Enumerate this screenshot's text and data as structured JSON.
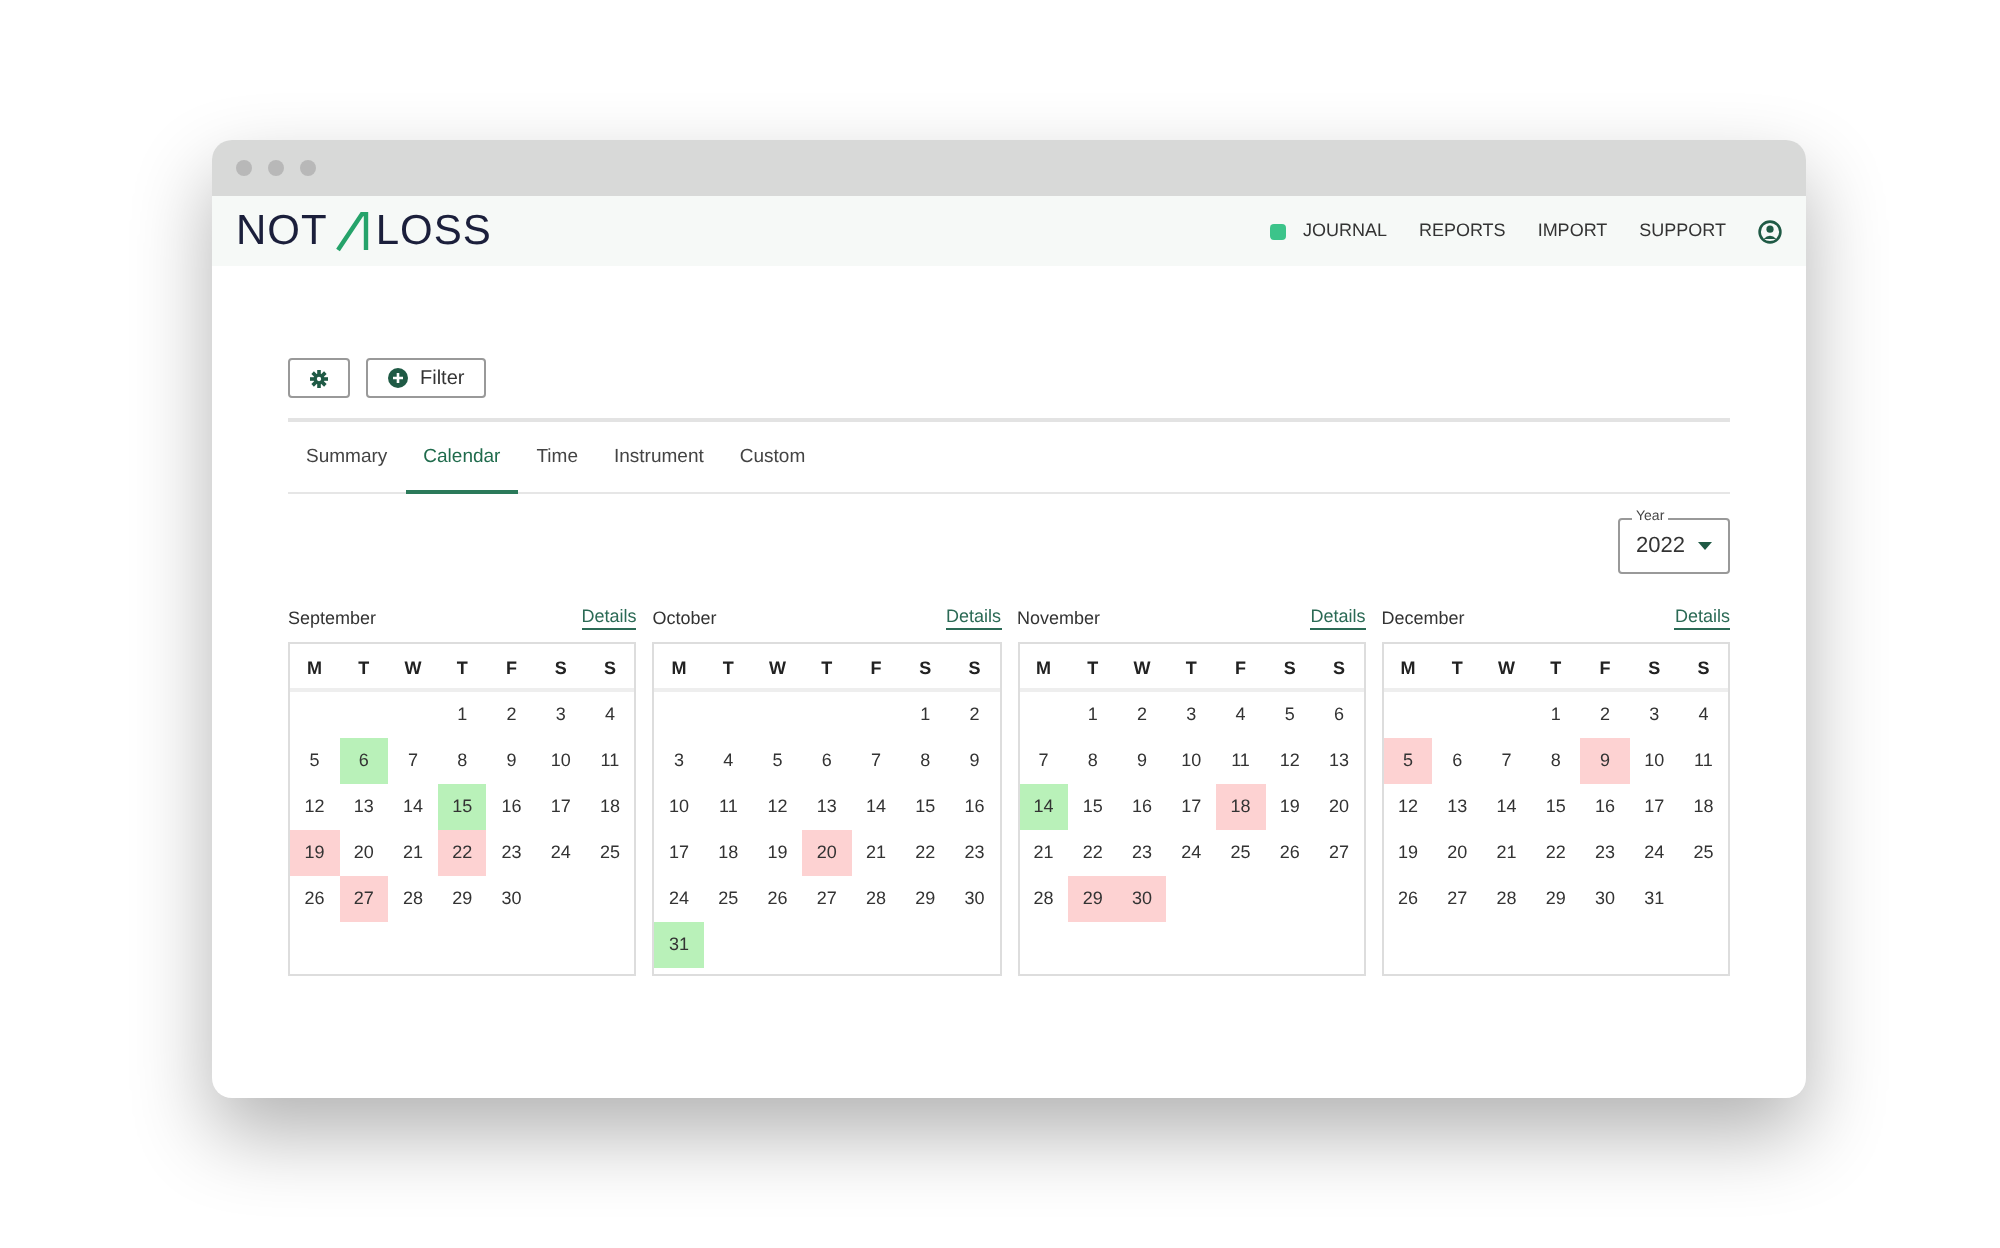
{
  "logo": {
    "left": "NOT",
    "right": "LOSS"
  },
  "nav": [
    {
      "label": "JOURNAL",
      "kind": "journal"
    },
    {
      "label": "REPORTS",
      "kind": "plain"
    },
    {
      "label": "IMPORT",
      "kind": "plain"
    },
    {
      "label": "SUPPORT",
      "kind": "plain"
    }
  ],
  "toolbar": {
    "filter": "Filter"
  },
  "tabs": [
    {
      "label": "Summary",
      "selected": false
    },
    {
      "label": "Calendar",
      "selected": true
    },
    {
      "label": "Time",
      "selected": false
    },
    {
      "label": "Instrument",
      "selected": false
    },
    {
      "label": "Custom",
      "selected": false
    }
  ],
  "year": {
    "label": "Year",
    "value": "2022"
  },
  "months": [
    {
      "name": "September",
      "details": "Details",
      "weekdays": [
        "M",
        "T",
        "W",
        "T",
        "F",
        "S",
        "S"
      ],
      "weeks": [
        [
          {
            "day": "1"
          },
          {
            "day": "2"
          },
          {
            "day": "3"
          },
          {
            "day": "4"
          }
        ],
        [
          {
            "day": "5"
          },
          {
            "day": "6",
            "color": "#b9f1b9"
          },
          {
            "day": "7"
          },
          {
            "day": "8"
          },
          {
            "day": "9"
          },
          {
            "day": "10"
          },
          {
            "day": "11"
          }
        ],
        [
          {
            "day": "12"
          },
          {
            "day": "13"
          },
          {
            "day": "14"
          },
          {
            "day": "15",
            "color": "#b9f1b9"
          },
          {
            "day": "16"
          },
          {
            "day": "17"
          },
          {
            "day": "18"
          }
        ],
        [
          {
            "day": "19",
            "color": "#fdd2d2"
          },
          {
            "day": "20"
          },
          {
            "day": "21"
          },
          {
            "day": "22",
            "color": "#fdd2d2"
          },
          {
            "day": "23"
          },
          {
            "day": "24"
          },
          {
            "day": "25"
          }
        ],
        [
          {
            "day": "26"
          },
          {
            "day": "27",
            "color": "#fdd2d2"
          },
          {
            "day": "28"
          },
          {
            "day": "29"
          },
          {
            "day": "30"
          }
        ]
      ]
    },
    {
      "name": "October",
      "details": "Details",
      "weekdays": [
        "M",
        "T",
        "W",
        "T",
        "F",
        "S",
        "S"
      ],
      "weeks": [
        [
          {
            "day": "1"
          },
          {
            "day": "2"
          }
        ],
        [
          {
            "day": "3"
          },
          {
            "day": "4"
          },
          {
            "day": "5"
          },
          {
            "day": "6"
          },
          {
            "day": "7"
          },
          {
            "day": "8"
          },
          {
            "day": "9"
          }
        ],
        [
          {
            "day": "10"
          },
          {
            "day": "11"
          },
          {
            "day": "12"
          },
          {
            "day": "13"
          },
          {
            "day": "14"
          },
          {
            "day": "15"
          },
          {
            "day": "16"
          }
        ],
        [
          {
            "day": "17"
          },
          {
            "day": "18"
          },
          {
            "day": "19"
          },
          {
            "day": "20",
            "color": "#fdd2d2"
          },
          {
            "day": "21"
          },
          {
            "day": "22"
          },
          {
            "day": "23"
          }
        ],
        [
          {
            "day": "24"
          },
          {
            "day": "25"
          },
          {
            "day": "26"
          },
          {
            "day": "27"
          },
          {
            "day": "28"
          },
          {
            "day": "29"
          },
          {
            "day": "30"
          }
        ],
        [
          {
            "day": "31",
            "color": "#b9f1b9"
          }
        ]
      ]
    },
    {
      "name": "November",
      "details": "Details",
      "weekdays": [
        "M",
        "T",
        "W",
        "T",
        "F",
        "S",
        "S"
      ],
      "weeks": [
        [
          {
            "day": "1"
          },
          {
            "day": "2"
          },
          {
            "day": "3"
          },
          {
            "day": "4"
          },
          {
            "day": "5"
          },
          {
            "day": "6"
          }
        ],
        [
          {
            "day": "7"
          },
          {
            "day": "8"
          },
          {
            "day": "9"
          },
          {
            "day": "10"
          },
          {
            "day": "11"
          },
          {
            "day": "12"
          },
          {
            "day": "13"
          }
        ],
        [
          {
            "day": "14",
            "color": "#b9f1b9"
          },
          {
            "day": "15"
          },
          {
            "day": "16"
          },
          {
            "day": "17"
          },
          {
            "day": "18",
            "color": "#fdd2d2"
          },
          {
            "day": "19"
          },
          {
            "day": "20"
          }
        ],
        [
          {
            "day": "21"
          },
          {
            "day": "22"
          },
          {
            "day": "23"
          },
          {
            "day": "24"
          },
          {
            "day": "25"
          },
          {
            "day": "26"
          },
          {
            "day": "27"
          }
        ],
        [
          {
            "day": "28"
          },
          {
            "day": "29",
            "color": "#fdd2d2"
          },
          {
            "day": "30",
            "color": "#fdd2d2"
          }
        ]
      ]
    },
    {
      "name": "December",
      "details": "Details",
      "weekdays": [
        "M",
        "T",
        "W",
        "T",
        "F",
        "S",
        "S"
      ],
      "weeks": [
        [
          {
            "day": "1"
          },
          {
            "day": "2"
          },
          {
            "day": "3"
          },
          {
            "day": "4"
          }
        ],
        [
          {
            "day": "5",
            "color": "#fdd2d2"
          },
          {
            "day": "6"
          },
          {
            "day": "7"
          },
          {
            "day": "8"
          },
          {
            "day": "9",
            "color": "#fdd2d2"
          },
          {
            "day": "10"
          },
          {
            "day": "11"
          }
        ],
        [
          {
            "day": "12"
          },
          {
            "day": "13"
          },
          {
            "day": "14"
          },
          {
            "day": "15"
          },
          {
            "day": "16"
          },
          {
            "day": "17"
          },
          {
            "day": "18"
          }
        ],
        [
          {
            "day": "19"
          },
          {
            "day": "20"
          },
          {
            "day": "21"
          },
          {
            "day": "22"
          },
          {
            "day": "23"
          },
          {
            "day": "24"
          },
          {
            "day": "25"
          }
        ],
        [
          {
            "day": "26"
          },
          {
            "day": "27"
          },
          {
            "day": "28"
          },
          {
            "day": "29"
          },
          {
            "day": "30"
          },
          {
            "day": "31"
          }
        ]
      ]
    }
  ]
}
